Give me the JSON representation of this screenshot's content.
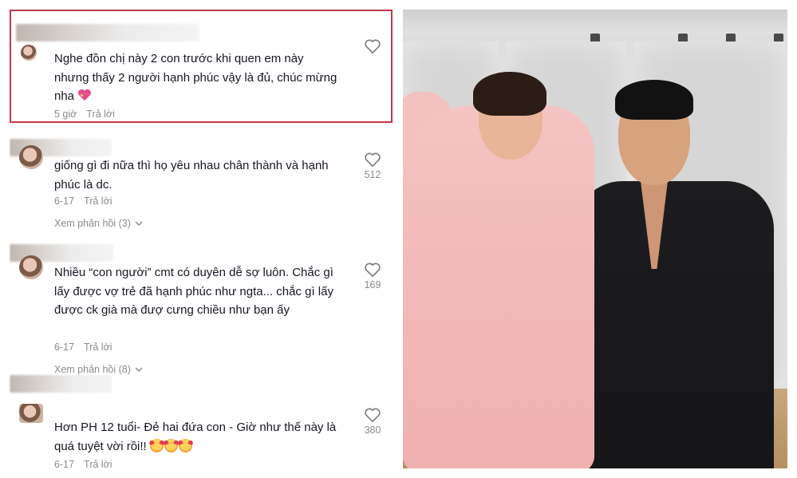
{
  "comments": [
    {
      "text": "Nghe đồn chị này 2 con trước khi quen em này nhưng thấy 2 người hạnh phúc vậy là đủ, chúc mừng nha",
      "time": "5 giờ",
      "reply_label": "Trả lời",
      "likes": "",
      "view_replies": ""
    },
    {
      "text": "giống gì đi nữa thì họ yêu nhau chân thành và hạnh phúc là dc.",
      "time": "6-17",
      "reply_label": "Trả lời",
      "likes": "512",
      "view_replies": "Xem phản hồi (3)"
    },
    {
      "text": "Nhiều “con người” cmt có duyên dễ sợ luôn. Chắc gì lấy được vợ trẻ đã hạnh phúc như ngta... chắc gì lấy được ck già mà đượ cưng chiều như bạn ấy",
      "time": "6-17",
      "reply_label": "Trả lời",
      "likes": "169",
      "view_replies": "Xem phản hồi (8)"
    },
    {
      "text": "Hơn PH 12 tuổi- Đẻ hai đứa con - Giờ như thế này là quá tuyệt vời rồi!!",
      "time": "6-17",
      "reply_label": "Trả lời",
      "likes": "380",
      "view_replies": ""
    }
  ],
  "colors": {
    "highlight_border": "#c0394a",
    "text": "#161823",
    "muted": "#8a8b91"
  },
  "icons": {
    "like": "heart-outline-icon",
    "chevron": "chevron-down-icon"
  }
}
